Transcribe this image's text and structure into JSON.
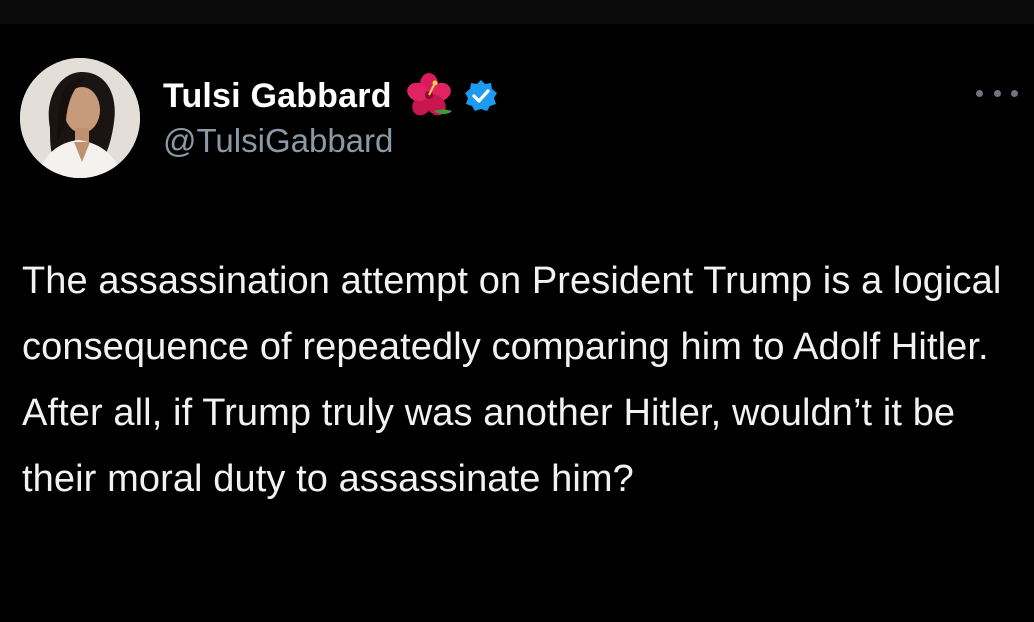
{
  "tweet": {
    "author": {
      "display_name": "Tulsi Gabbard",
      "handle": "@TulsiGabbard",
      "name_emoji": "hibiscus-icon",
      "verified": true,
      "verified_icon": "verified-badge-icon"
    },
    "more_icon": "more-options-icon",
    "text": "The assassination attempt on President Trump is a logical consequence of repeatedly comparing him to Adolf Hitler. After all, if Trump truly was another Hitler, wouldn’t it be their moral duty to assassinate him?"
  },
  "colors": {
    "background": "#000000",
    "text": "#ffffff",
    "handle": "#8b98a5",
    "verified": "#1d9bf0",
    "hibiscus": "#d81b5a"
  }
}
